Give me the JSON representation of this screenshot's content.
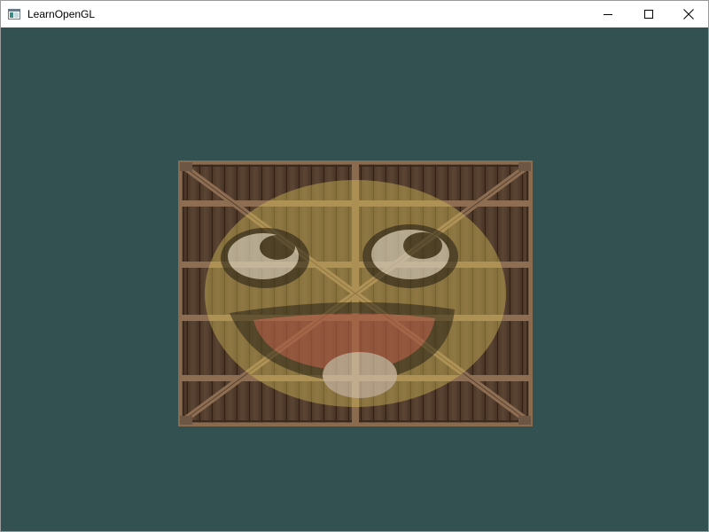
{
  "window": {
    "title": "LearnOpenGL",
    "app_icon": "window-app-icon",
    "controls": {
      "minimize_icon": "minimize-icon",
      "maximize_icon": "maximize-icon",
      "close_icon": "close-icon"
    }
  },
  "scene": {
    "clear_color": "#335151",
    "textures": {
      "base": "wooden-container",
      "overlay": "awesomeface"
    },
    "overlay_mix": 0.2,
    "colors": {
      "wood_dark": "#3e2d22",
      "wood_plank": "#5a4332",
      "wood_frame": "#8b6a4e",
      "face_yellow": "#d9c15a",
      "face_dark": "#2a2418",
      "tongue": "#9a3a3a",
      "eye_white": "#d8d4cf"
    }
  }
}
